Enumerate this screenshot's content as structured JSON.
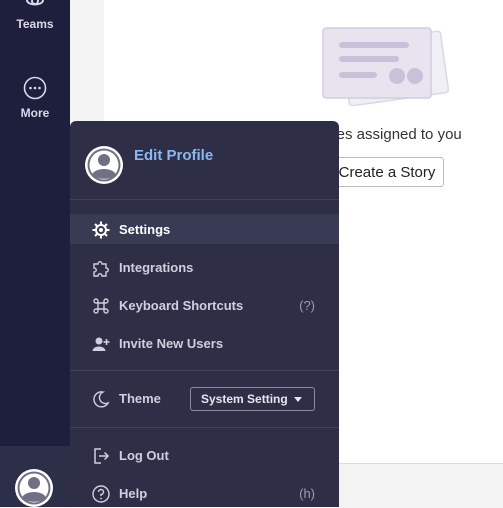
{
  "leftnav": {
    "teams_label": "Teams",
    "more_label": "More"
  },
  "content": {
    "empty_text": "ories assigned to you",
    "create_button": "Create a Story"
  },
  "menu": {
    "edit_profile": "Edit Profile",
    "items": [
      {
        "label": "Settings",
        "icon": "gear-icon",
        "active": true
      },
      {
        "label": "Integrations",
        "icon": "puzzle-icon"
      },
      {
        "label": "Keyboard Shortcuts",
        "icon": "command-icon",
        "hint": "(?)"
      },
      {
        "label": "Invite New Users",
        "icon": "add-user-icon"
      }
    ],
    "theme": {
      "label": "Theme",
      "icon": "moon-icon",
      "selected": "System Setting"
    },
    "footer_items": [
      {
        "label": "Log Out",
        "icon": "logout-icon"
      },
      {
        "label": "Help",
        "icon": "help-icon",
        "hint": "(h)"
      }
    ]
  },
  "colors": {
    "nav_bg": "#1e1f3c",
    "menu_bg": "#2e2f47",
    "link": "#8ab8f0"
  }
}
